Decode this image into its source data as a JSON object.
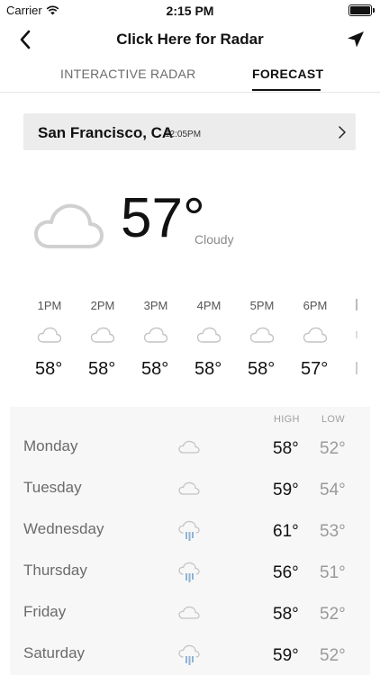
{
  "status": {
    "carrier": "Carrier",
    "time": "2:15 PM"
  },
  "nav": {
    "title": "Click Here for Radar"
  },
  "tabs": {
    "radar": "INTERACTIVE RADAR",
    "forecast": "FORECAST",
    "active": "forecast"
  },
  "location": {
    "city": "San Francisco, CA",
    "time": "12:05PM"
  },
  "current": {
    "temp": "57°",
    "condition": "Cloudy",
    "icon": "cloud-icon"
  },
  "hourly": [
    {
      "label": "1PM",
      "temp": "58°",
      "icon": "cloud-icon"
    },
    {
      "label": "2PM",
      "temp": "58°",
      "icon": "cloud-icon"
    },
    {
      "label": "3PM",
      "temp": "58°",
      "icon": "cloud-icon"
    },
    {
      "label": "4PM",
      "temp": "58°",
      "icon": "cloud-icon"
    },
    {
      "label": "5PM",
      "temp": "58°",
      "icon": "cloud-icon"
    },
    {
      "label": "6PM",
      "temp": "57°",
      "icon": "cloud-icon"
    }
  ],
  "daily": {
    "high_label": "HIGH",
    "low_label": "LOW",
    "days": [
      {
        "name": "Monday",
        "high": "58°",
        "low": "52°",
        "icon": "cloud-icon"
      },
      {
        "name": "Tuesday",
        "high": "59°",
        "low": "54°",
        "icon": "cloud-icon"
      },
      {
        "name": "Wednesday",
        "high": "61°",
        "low": "53°",
        "icon": "rain-cloud-icon"
      },
      {
        "name": "Thursday",
        "high": "56°",
        "low": "51°",
        "icon": "rain-cloud-icon"
      },
      {
        "name": "Friday",
        "high": "58°",
        "low": "52°",
        "icon": "cloud-icon"
      },
      {
        "name": "Saturday",
        "high": "59°",
        "low": "52°",
        "icon": "rain-cloud-icon"
      }
    ]
  },
  "colors": {
    "rain": "#8fb3d9",
    "cloud_outline": "#c8c8c8"
  }
}
